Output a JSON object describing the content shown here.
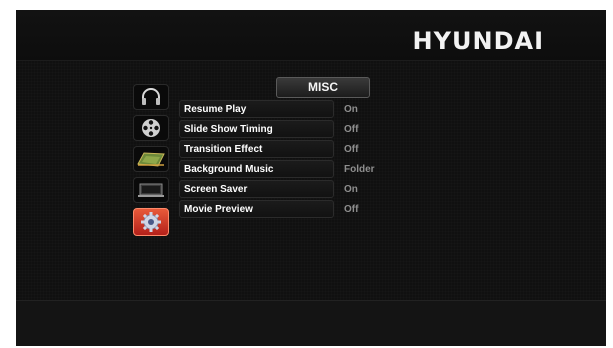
{
  "brand": {
    "logo": "HYUNDAI"
  },
  "category_tab": {
    "label": "MISC"
  },
  "categories": [
    {
      "icon": "headphones-icon",
      "active": false
    },
    {
      "icon": "film-reel-icon",
      "active": false
    },
    {
      "icon": "photo-icon",
      "active": false
    },
    {
      "icon": "display-icon",
      "active": false
    },
    {
      "icon": "gear-icon",
      "active": true
    }
  ],
  "settings": [
    {
      "label": "Resume Play",
      "value": "On"
    },
    {
      "label": "Slide Show Timing",
      "value": "Off"
    },
    {
      "label": "Transition Effect",
      "value": "Off"
    },
    {
      "label": "Background Music",
      "value": "Folder"
    },
    {
      "label": "Screen Saver",
      "value": "On"
    },
    {
      "label": "Movie Preview",
      "value": "Off"
    }
  ],
  "colors": {
    "screen_bg": "#101010",
    "active_icon": "#d8402a",
    "value_text": "#8e8e8e"
  }
}
